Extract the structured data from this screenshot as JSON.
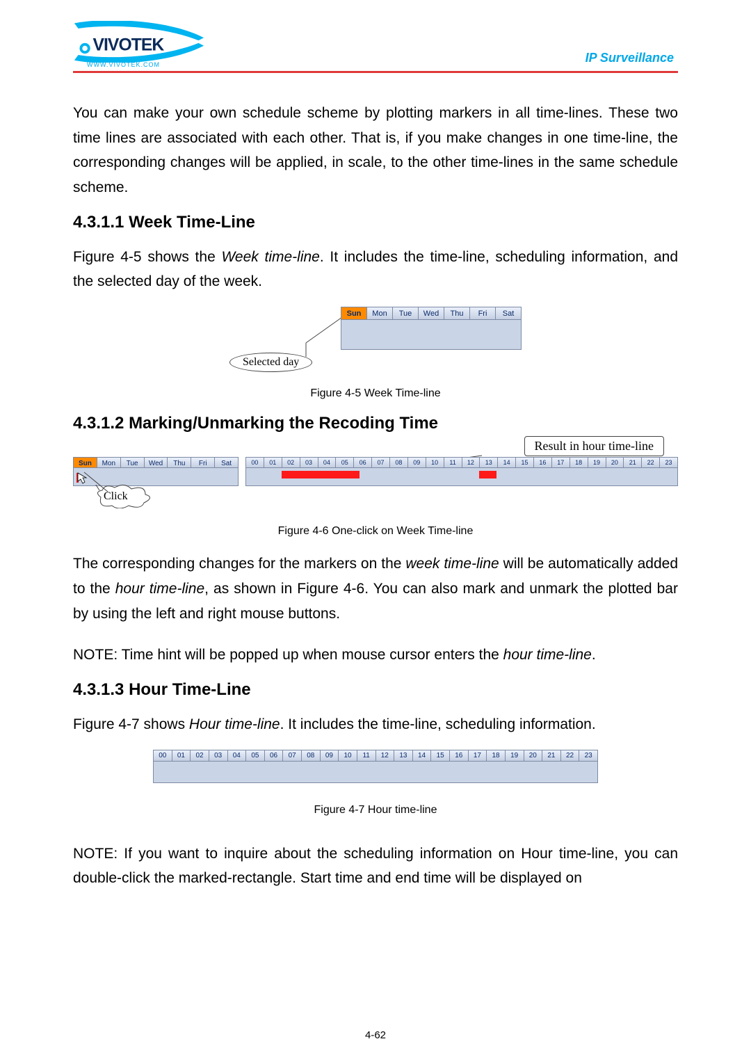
{
  "header": {
    "logo_under": "WWW.VIVOTEK.COM",
    "ip": "IP Surveillance"
  },
  "para_intro": "You can make your own schedule scheme by plotting markers in all time-lines. These two time lines are associated with each other. That is, if you make changes in one time-line, the corresponding changes will be applied, in scale, to the other time-lines in the same schedule scheme.",
  "sec1": "4.3.1.1 Week Time-Line",
  "para_sec1_a": "Figure 4-5 shows the ",
  "para_sec1_em": "Week time-line",
  "para_sec1_b": ". It includes the time-line, scheduling information, and the selected day of the week.",
  "days": [
    "Sun",
    "Mon",
    "Tue",
    "Wed",
    "Thu",
    "Fri",
    "Sat"
  ],
  "selected_day_label": "Selected day",
  "fig45_cap": "Figure 4-5 Week Time-line",
  "sec2": "4.3.1.2 Marking/Unmarking the Recoding Time",
  "result_label": "Result in hour time-line",
  "click_label": "Click",
  "hours": [
    "00",
    "01",
    "02",
    "03",
    "04",
    "05",
    "06",
    "07",
    "08",
    "09",
    "10",
    "11",
    "12",
    "13",
    "14",
    "15",
    "16",
    "17",
    "18",
    "19",
    "20",
    "21",
    "22",
    "23"
  ],
  "fig46_cap": "Figure 4-6 One-click on Week Time-line",
  "para_sec2_a": "The corresponding changes for the markers on the ",
  "para_sec2_em1": "week time-line",
  "para_sec2_b": " will be automatically added to the ",
  "para_sec2_em2": "hour time-line",
  "para_sec2_c": ", as shown in Figure 4-6. You can also mark and unmark the plotted bar by using the left and right mouse buttons.",
  "note1_a": "NOTE: Time hint will be popped up when mouse cursor enters the ",
  "note1_em": "hour time-line",
  "note1_b": ".",
  "sec3": "4.3.1.3 Hour Time-Line",
  "para_sec3_a": "Figure 4-7 shows ",
  "para_sec3_em": "Hour time-line",
  "para_sec3_b": ". It includes the time-line, scheduling information.",
  "fig47_cap": "Figure 4-7 Hour time-line",
  "note2": "NOTE: If you want to inquire about the scheduling information on Hour time-line, you can double-click the marked-rectangle. Start time and end time will be displayed on",
  "page_num": "4-62",
  "chart_data": [
    {
      "type": "table",
      "name": "week-timeline-fig45",
      "categories": [
        "Sun",
        "Mon",
        "Tue",
        "Wed",
        "Thu",
        "Fri",
        "Sat"
      ],
      "selected": "Sun"
    },
    {
      "type": "table",
      "name": "week-and-hour-fig46",
      "week_categories": [
        "Sun",
        "Mon",
        "Tue",
        "Wed",
        "Thu",
        "Fri",
        "Sat"
      ],
      "week_selected": "Sun",
      "hour_categories": [
        "00",
        "01",
        "02",
        "03",
        "04",
        "05",
        "06",
        "07",
        "08",
        "09",
        "10",
        "11",
        "12",
        "13",
        "14",
        "15",
        "16",
        "17",
        "18",
        "19",
        "20",
        "21",
        "22",
        "23"
      ],
      "marked_ranges_hours": [
        [
          2,
          6
        ],
        [
          13,
          14
        ]
      ]
    },
    {
      "type": "table",
      "name": "hour-timeline-fig47",
      "categories": [
        "00",
        "01",
        "02",
        "03",
        "04",
        "05",
        "06",
        "07",
        "08",
        "09",
        "10",
        "11",
        "12",
        "13",
        "14",
        "15",
        "16",
        "17",
        "18",
        "19",
        "20",
        "21",
        "22",
        "23"
      ]
    }
  ]
}
